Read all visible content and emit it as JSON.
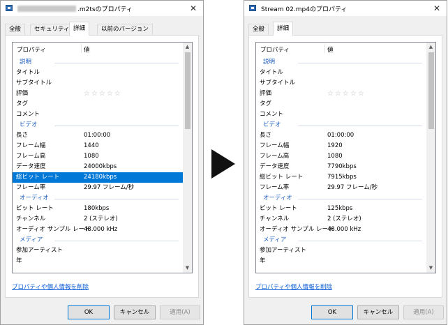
{
  "left_dialog": {
    "title": ".m2tsのプロパティ",
    "tabs": [
      "全般",
      "セキュリティ",
      "詳細",
      "以前のバージョン"
    ],
    "active_tab": "詳細",
    "header": {
      "name": "プロパティ",
      "value": "値"
    },
    "rows": [
      {
        "type": "group",
        "name": "説明",
        "value": ""
      },
      {
        "type": "row",
        "name": "タイトル",
        "value": ""
      },
      {
        "type": "row",
        "name": "サブタイトル",
        "value": ""
      },
      {
        "type": "stars",
        "name": "評価",
        "value": "☆☆☆☆☆"
      },
      {
        "type": "row",
        "name": "タグ",
        "value": ""
      },
      {
        "type": "row",
        "name": "コメント",
        "value": ""
      },
      {
        "type": "group",
        "name": "ビデオ",
        "value": ""
      },
      {
        "type": "row",
        "name": "長さ",
        "value": "01:00:00"
      },
      {
        "type": "row",
        "name": "フレーム幅",
        "value": "1440"
      },
      {
        "type": "row",
        "name": "フレーム高",
        "value": "1080"
      },
      {
        "type": "row",
        "name": "データ速度",
        "value": "24000kbps"
      },
      {
        "type": "selected",
        "name": "総ビット レート",
        "value": "24180kbps"
      },
      {
        "type": "row",
        "name": "フレーム率",
        "value": "29.97 フレーム/秒"
      },
      {
        "type": "group",
        "name": "オーディオ",
        "value": ""
      },
      {
        "type": "row",
        "name": "ビット レート",
        "value": "180kbps"
      },
      {
        "type": "row",
        "name": "チャンネル",
        "value": "2 (ステレオ)"
      },
      {
        "type": "row",
        "name": "オーディオ サンプル レート",
        "value": "48.000 kHz"
      },
      {
        "type": "group",
        "name": "メディア",
        "value": ""
      },
      {
        "type": "row",
        "name": "参加アーティスト",
        "value": ""
      },
      {
        "type": "row",
        "name": "年",
        "value": ""
      }
    ],
    "remove_link": "プロパティや個人情報を削除",
    "buttons": {
      "ok": "OK",
      "cancel": "キャンセル",
      "apply": "適用(A)"
    }
  },
  "right_dialog": {
    "title": "Stream 02.mp4のプロパティ",
    "tabs": [
      "全般",
      "詳細"
    ],
    "active_tab": "詳細",
    "header": {
      "name": "プロパティ",
      "value": "値"
    },
    "rows": [
      {
        "type": "group",
        "name": "説明",
        "value": ""
      },
      {
        "type": "row",
        "name": "タイトル",
        "value": ""
      },
      {
        "type": "row",
        "name": "サブタイトル",
        "value": ""
      },
      {
        "type": "stars",
        "name": "評価",
        "value": "☆☆☆☆☆"
      },
      {
        "type": "row",
        "name": "タグ",
        "value": ""
      },
      {
        "type": "row",
        "name": "コメント",
        "value": ""
      },
      {
        "type": "group",
        "name": "ビデオ",
        "value": ""
      },
      {
        "type": "row",
        "name": "長さ",
        "value": "01:00:00"
      },
      {
        "type": "row",
        "name": "フレーム幅",
        "value": "1920"
      },
      {
        "type": "row",
        "name": "フレーム高",
        "value": "1080"
      },
      {
        "type": "row",
        "name": "データ速度",
        "value": "7790kbps"
      },
      {
        "type": "row",
        "name": "総ビット レート",
        "value": "7915kbps"
      },
      {
        "type": "row",
        "name": "フレーム率",
        "value": "29.97 フレーム/秒"
      },
      {
        "type": "group",
        "name": "オーディオ",
        "value": ""
      },
      {
        "type": "row",
        "name": "ビット レート",
        "value": "125kbps"
      },
      {
        "type": "row",
        "name": "チャンネル",
        "value": "2 (ステレオ)"
      },
      {
        "type": "row",
        "name": "オーディオ サンプル レート",
        "value": "48.000 kHz"
      },
      {
        "type": "group",
        "name": "メディア",
        "value": ""
      },
      {
        "type": "row",
        "name": "参加アーティスト",
        "value": ""
      },
      {
        "type": "row",
        "name": "年",
        "value": ""
      }
    ],
    "remove_link": "プロパティや個人情報を削除",
    "buttons": {
      "ok": "OK",
      "cancel": "キャンセル",
      "apply": "適用(A)"
    }
  },
  "colors": {
    "selection": "#0078d7",
    "group_text": "#1f5fbf",
    "link": "#0b5ed7",
    "arrow": "#111111"
  },
  "icons": [
    "video-file-icon",
    "close-icon",
    "scroll-up-icon",
    "scroll-down-icon",
    "right-arrow-icon"
  ]
}
